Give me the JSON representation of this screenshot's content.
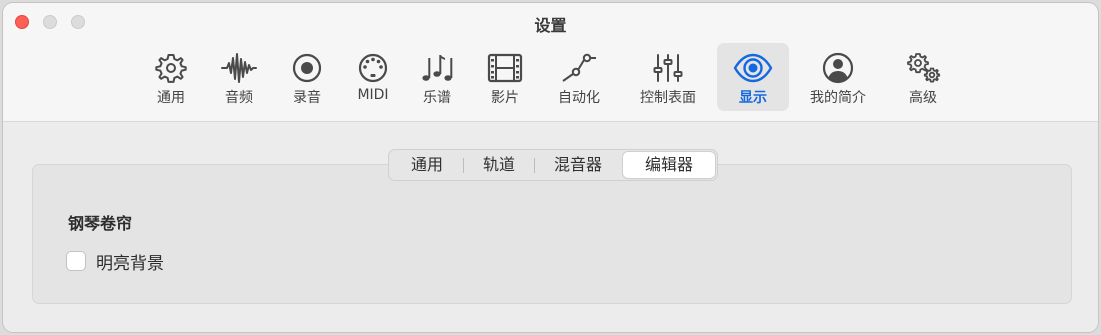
{
  "window": {
    "title": "设置"
  },
  "toolbar": {
    "items": [
      {
        "label": "通用",
        "icon": "gear-icon"
      },
      {
        "label": "音频",
        "icon": "waveform-icon"
      },
      {
        "label": "录音",
        "icon": "record-icon"
      },
      {
        "label": "MIDI",
        "icon": "midi-port-icon"
      },
      {
        "label": "乐谱",
        "icon": "music-notes-icon"
      },
      {
        "label": "影片",
        "icon": "film-icon"
      },
      {
        "label": "自动化",
        "icon": "automation-curve-icon"
      },
      {
        "label": "控制表面",
        "icon": "sliders-icon"
      },
      {
        "label": "显示",
        "icon": "eye-icon",
        "active": true
      },
      {
        "label": "我的简介",
        "icon": "person-circle-icon"
      },
      {
        "label": "高级",
        "icon": "gears-icon"
      }
    ]
  },
  "tabs": {
    "items": [
      {
        "label": "通用"
      },
      {
        "label": "轨道"
      },
      {
        "label": "混音器"
      },
      {
        "label": "编辑器",
        "active": true
      }
    ]
  },
  "section": {
    "title": "钢琴卷帘"
  },
  "option": {
    "label": "明亮背景",
    "checked": false
  },
  "colors": {
    "accent": "#1468e0",
    "close": "#fe5f57",
    "icon": "#4a4a4a"
  }
}
